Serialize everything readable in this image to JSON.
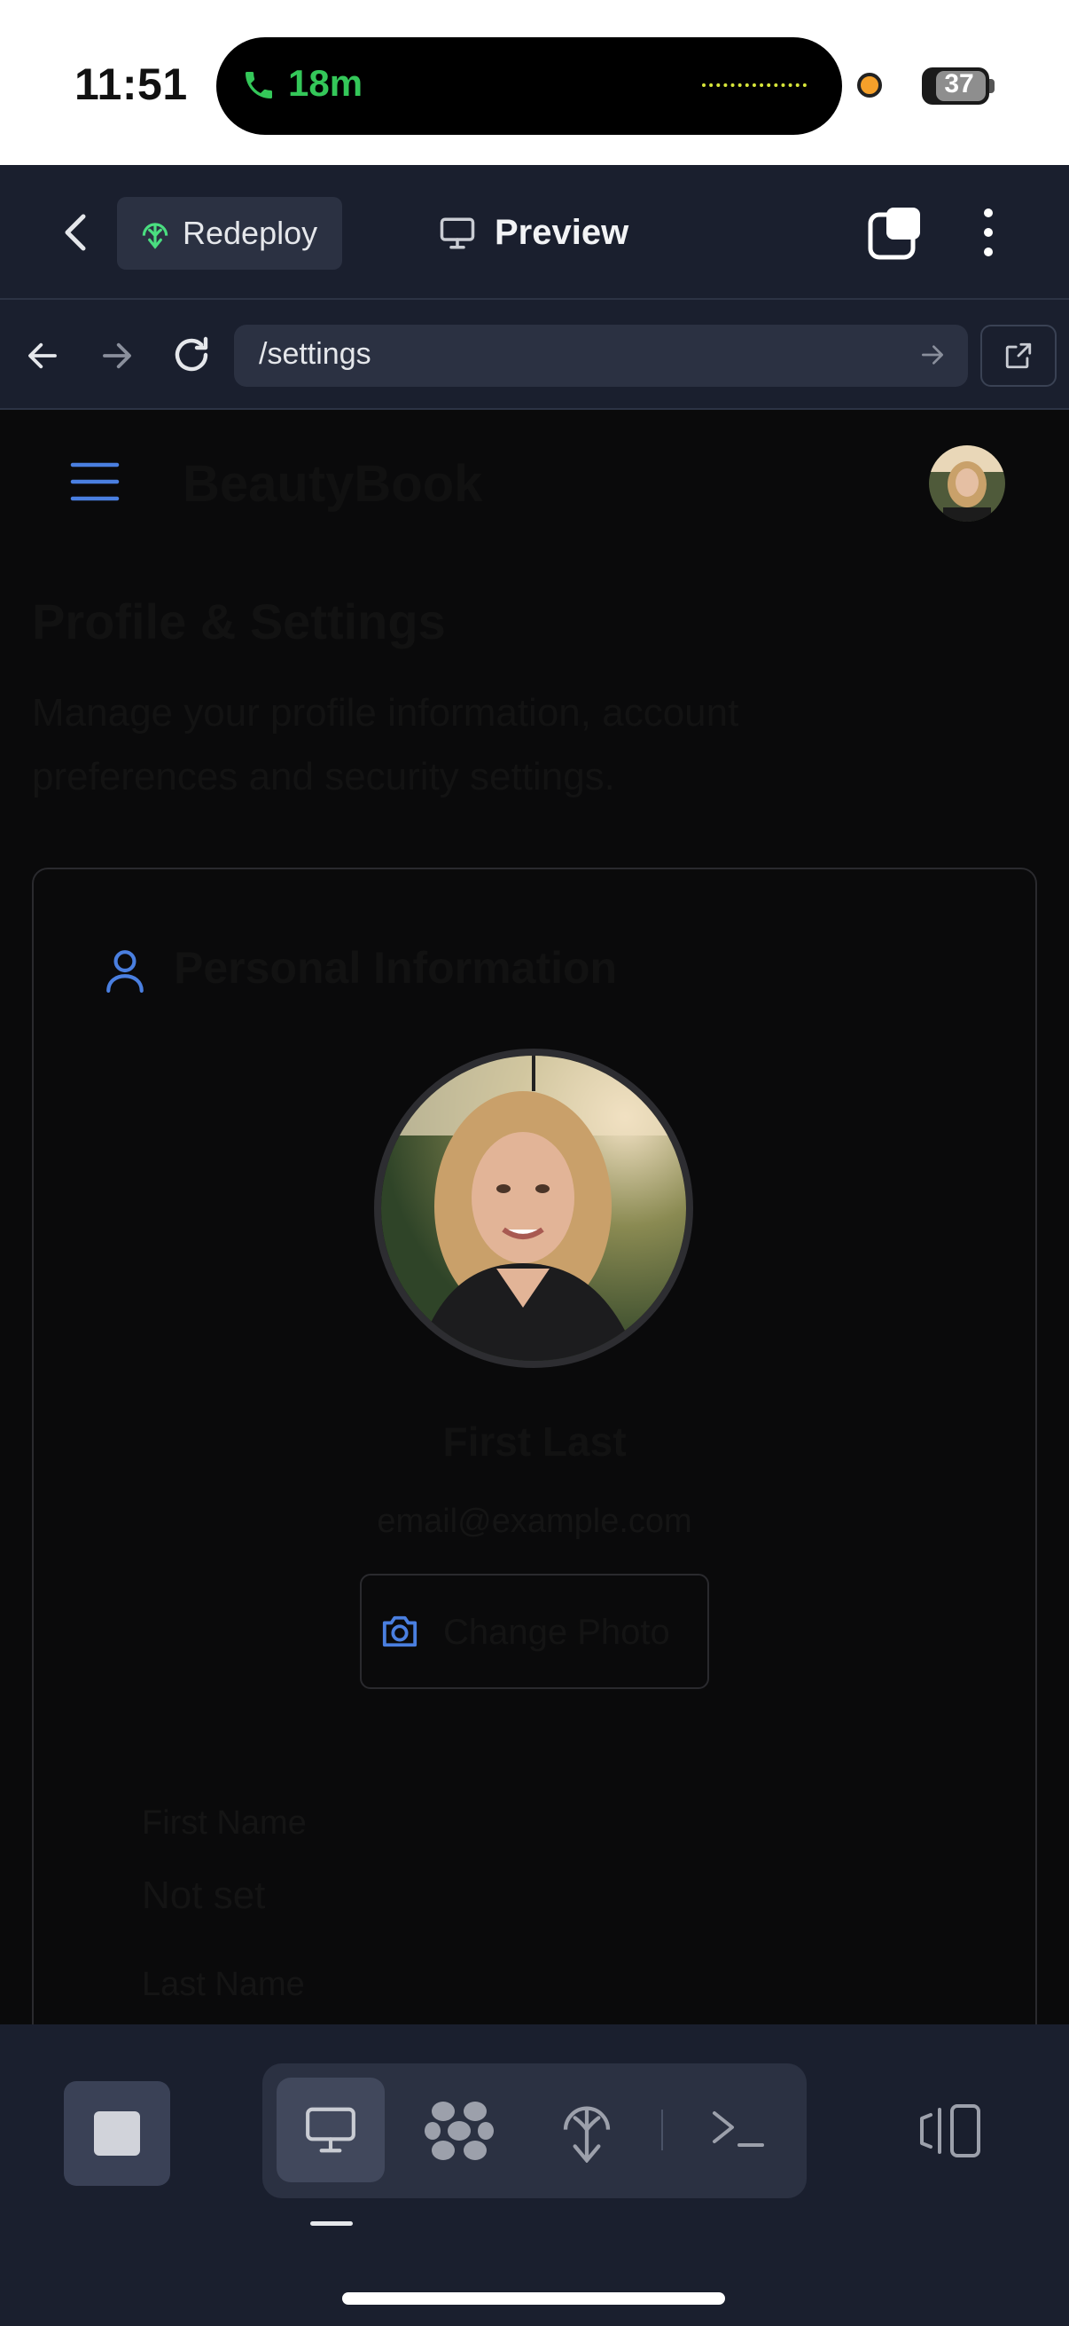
{
  "status_bar": {
    "time": "11:51",
    "call_duration": "18m",
    "battery": "37"
  },
  "app_header": {
    "redeploy_label": "Redeploy",
    "preview_label": "Preview"
  },
  "url_bar": {
    "url": "/settings"
  },
  "page": {
    "brand": "BeautyBook",
    "title": "Profile & Settings",
    "subtitle": "Manage your profile information, account preferences and security settings.",
    "card": {
      "title": "Personal Information",
      "name": "First Last",
      "email": "email@example.com",
      "change_photo": "Change Photo",
      "fields": [
        {
          "label": "First Name",
          "value": "Not set"
        },
        {
          "label": "Last Name"
        }
      ]
    }
  },
  "colors": {
    "accent_blue": "#4a7fe0",
    "call_green": "#34c759",
    "toolbar_bg": "#1a1f2e"
  }
}
